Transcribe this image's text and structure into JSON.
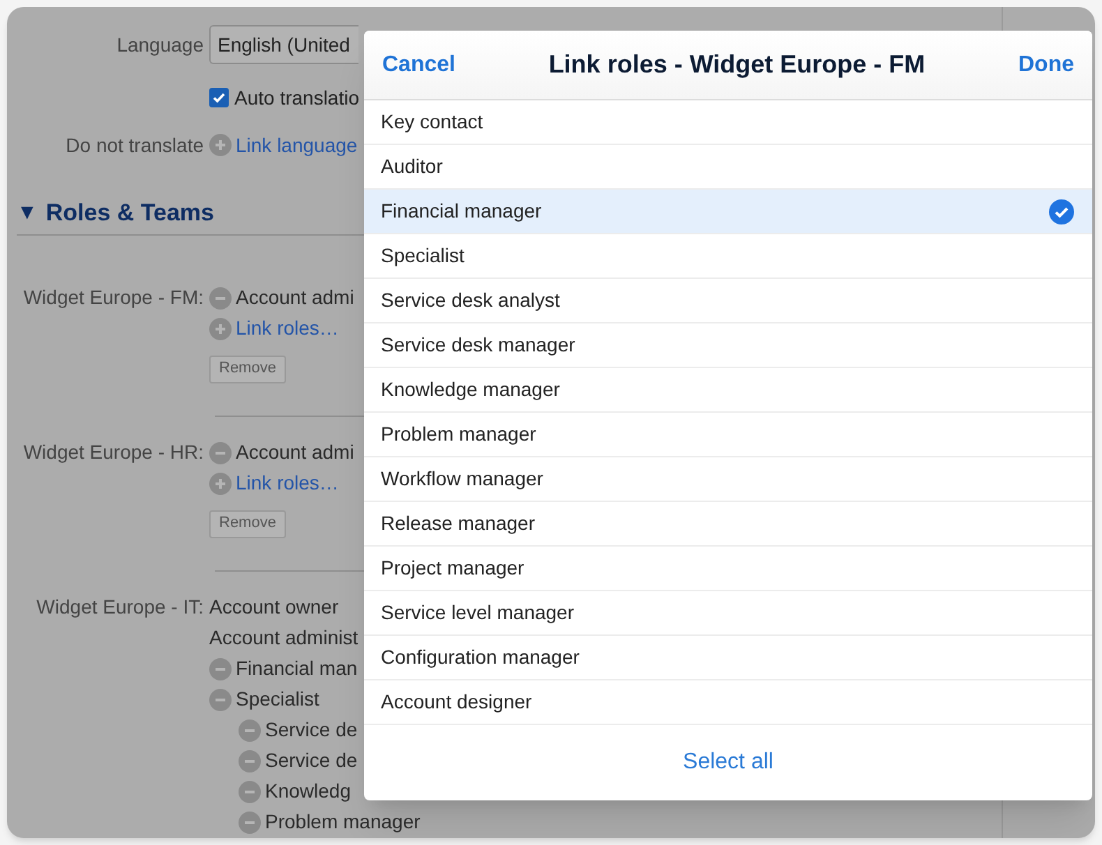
{
  "settings": {
    "language_label": "Language",
    "language_value": "English (United",
    "auto_translation": {
      "label": "Auto translatio",
      "checked": true
    },
    "do_not_translate": {
      "label": "Do not translate",
      "link": "Link language"
    }
  },
  "section": {
    "toggle": "▼",
    "title": "Roles & Teams",
    "expanded": true
  },
  "teams": [
    {
      "name": "Widget Europe - FM:",
      "entries": [
        {
          "kind": "remove",
          "text": "Account admi"
        },
        {
          "kind": "add",
          "text": "Link roles…"
        }
      ],
      "remove_button": "Remove"
    },
    {
      "name": "Widget Europe - HR:",
      "entries": [
        {
          "kind": "remove",
          "text": "Account admi"
        },
        {
          "kind": "add",
          "text": "Link roles…"
        }
      ],
      "remove_button": "Remove"
    },
    {
      "name": "Widget Europe - IT:",
      "entries": [
        {
          "kind": "plain",
          "text": "Account owner"
        },
        {
          "kind": "plain",
          "text": "Account administ"
        },
        {
          "kind": "remove",
          "text": "Financial man"
        },
        {
          "kind": "remove",
          "text": "Specialist",
          "children": [
            {
              "kind": "remove",
              "text": "Service de"
            },
            {
              "kind": "remove",
              "text": "Service de"
            },
            {
              "kind": "remove",
              "text": "Knowledg"
            },
            {
              "kind": "remove",
              "text": "Problem manager"
            }
          ]
        }
      ]
    }
  ],
  "dialog": {
    "cancel": "Cancel",
    "title": "Link roles - Widget Europe - FM",
    "done": "Done",
    "roles": [
      {
        "label": "Key contact",
        "selected": false
      },
      {
        "label": "Auditor",
        "selected": false
      },
      {
        "label": "Financial manager",
        "selected": true
      },
      {
        "label": "Specialist",
        "selected": false
      },
      {
        "label": "Service desk analyst",
        "selected": false
      },
      {
        "label": "Service desk manager",
        "selected": false
      },
      {
        "label": "Knowledge manager",
        "selected": false
      },
      {
        "label": "Problem manager",
        "selected": false
      },
      {
        "label": "Workflow manager",
        "selected": false
      },
      {
        "label": "Release manager",
        "selected": false
      },
      {
        "label": "Project manager",
        "selected": false
      },
      {
        "label": "Service level manager",
        "selected": false
      },
      {
        "label": "Configuration manager",
        "selected": false
      },
      {
        "label": "Account designer",
        "selected": false
      }
    ],
    "select_all": "Select all"
  }
}
